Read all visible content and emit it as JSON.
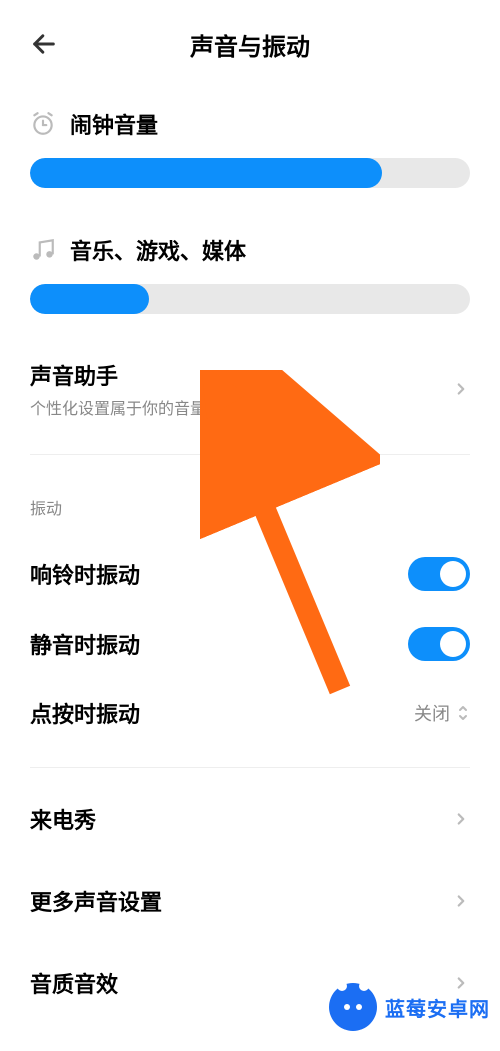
{
  "header": {
    "title": "声音与振动"
  },
  "sliders": {
    "alarm": {
      "label": "闹钟音量",
      "percent": 80
    },
    "media": {
      "label": "音乐、游戏、媒体",
      "percent": 27
    }
  },
  "nav": {
    "sound_assistant": {
      "title": "声音助手",
      "subtitle": "个性化设置属于你的音量控制逻辑"
    },
    "call_show": {
      "title": "来电秀"
    },
    "more_sounds": {
      "title": "更多声音设置"
    },
    "sound_effects": {
      "title": "音质音效"
    }
  },
  "vibration": {
    "section_label": "振动",
    "ring_vibrate": {
      "label": "响铃时振动",
      "on": true
    },
    "silent_vibrate": {
      "label": "静音时振动",
      "on": true
    },
    "tap_vibrate": {
      "label": "点按时振动",
      "value": "关闭"
    }
  },
  "watermark": {
    "text": "蓝莓安卓网"
  },
  "colors": {
    "accent": "#0d8ffb",
    "arrow": "#ff6a13"
  }
}
